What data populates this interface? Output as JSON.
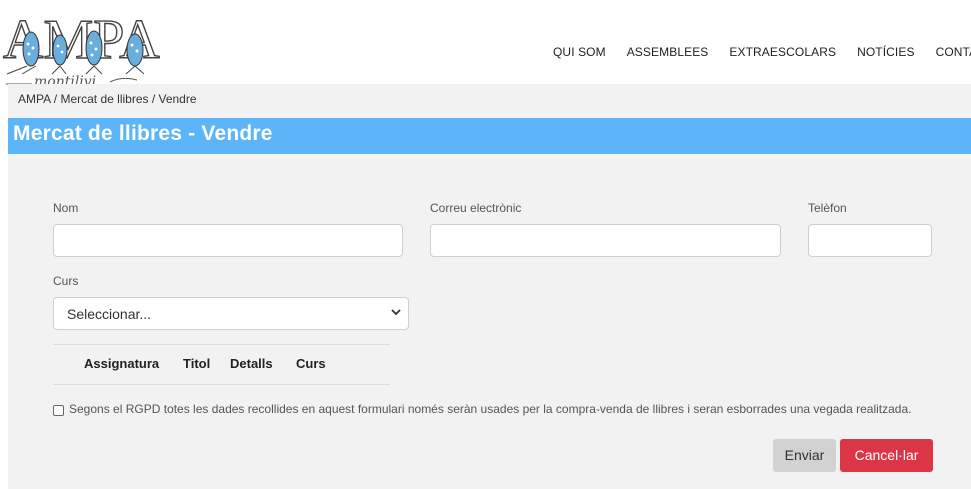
{
  "brand": {
    "logo_text": "AMPA",
    "logo_subtext": "montilivi"
  },
  "nav": [
    "QUI SOM",
    "ASSEMBLEES",
    "EXTRAESCOLARS",
    "NOTÍCIES",
    "CONTACTE"
  ],
  "breadcrumb": "AMPA / Mercat de llibres / Vendre",
  "page_title": "Mercat de llibres - Vendre",
  "form": {
    "name_label": "Nom",
    "email_label": "Correu electrònic",
    "phone_label": "Telèfon",
    "course_label": "Curs",
    "course_selected": "Seleccionar..."
  },
  "table": {
    "headers": [
      "Assignatura",
      "Titol",
      "Detalls",
      "Curs"
    ]
  },
  "consent_text": "Segons el RGPD totes les dades recollides en aquest formulari només seràn usades per la compra-venda de llibres i seran esborrades una vegada realitzada.",
  "buttons": {
    "send": "Enviar",
    "cancel": "Cancel·lar"
  },
  "colors": {
    "accent": "#5bb5f8",
    "danger": "#dc3545",
    "neutral_button": "#d2d2d2"
  }
}
